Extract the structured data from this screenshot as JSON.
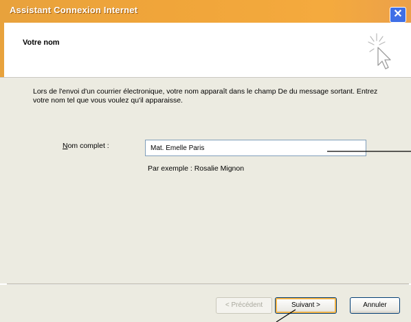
{
  "window": {
    "title": "Assistant Connexion Internet",
    "close_symbol": "✕"
  },
  "header": {
    "title": "Votre nom",
    "icon": "wizard-cursor-icon"
  },
  "content": {
    "description": "Lors de l'envoi d'un courrier électronique, votre nom apparaît dans le champ De du message sortant. Entrez votre nom tel que vous voulez qu'il apparaisse.",
    "name_field": {
      "label_accesskey": "N",
      "label_rest": "om complet :",
      "value": "Mat. Emelle Paris"
    },
    "example": "Par exemple : Rosalie Mignon"
  },
  "buttons": {
    "previous": "< Précédent",
    "next": "Suivant >",
    "cancel": "Annuler"
  },
  "colors": {
    "titlebar": "#f0a53a",
    "close_button": "#3f6fe6",
    "dialog_body": "#ecebe1",
    "default_button_highlight": "#f4b549"
  }
}
